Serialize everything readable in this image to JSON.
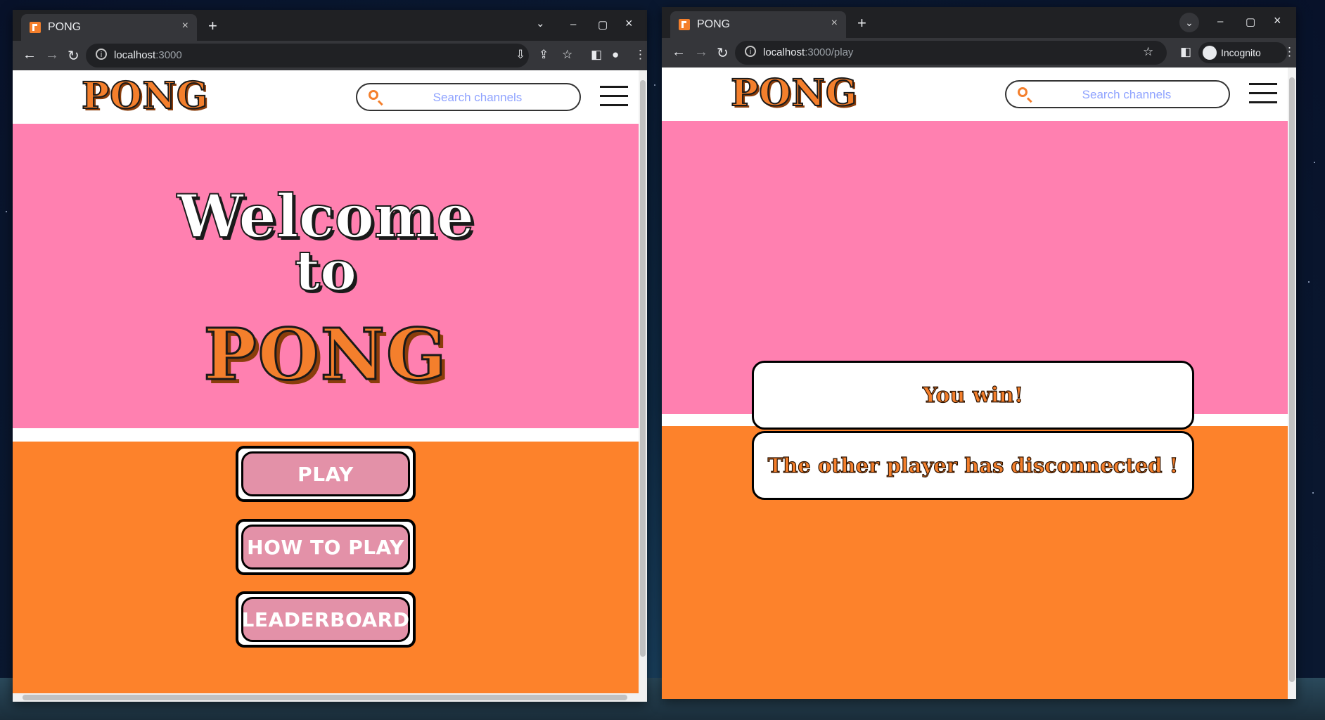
{
  "left_window": {
    "tab": {
      "title": "PONG",
      "close": "×"
    },
    "new_tab": "+",
    "controls": {
      "tab_list": "⌄",
      "minimize": "–",
      "maximize": "▢",
      "close": "×"
    },
    "url": {
      "host": "localhost",
      "path": ":3000"
    },
    "page": {
      "logo": "PONG",
      "search_placeholder": "Search channels",
      "hero_line1": "Welcome",
      "hero_line2": "to",
      "hero_title": "PONG",
      "buttons": [
        "PLAY",
        "HOW TO PLAY",
        "LEADERBOARD"
      ]
    }
  },
  "right_window": {
    "tab": {
      "title": "PONG",
      "close": "×"
    },
    "new_tab": "+",
    "controls": {
      "tab_list": "⌄",
      "minimize": "–",
      "maximize": "▢",
      "close": "×"
    },
    "url": {
      "host": "localhost",
      "path": ":3000/play"
    },
    "incognito_label": "Incognito",
    "page": {
      "logo": "PONG",
      "search_placeholder": "Search channels",
      "result": "You win!",
      "reason": "The other player has disconnected !"
    }
  },
  "colors": {
    "pink": "#ff80b0",
    "orange": "#fd822b",
    "button_pink": "#e391a8",
    "chrome_dark": "#202124",
    "chrome_toolbar": "#35363a"
  },
  "icons": [
    "back-arrow-icon",
    "forward-arrow-icon",
    "reload-icon",
    "info-icon",
    "install-icon",
    "share-icon",
    "star-icon",
    "side-panel-icon",
    "profile-icon",
    "kebab-menu-icon",
    "search-icon",
    "hamburger-menu-icon",
    "incognito-icon"
  ]
}
